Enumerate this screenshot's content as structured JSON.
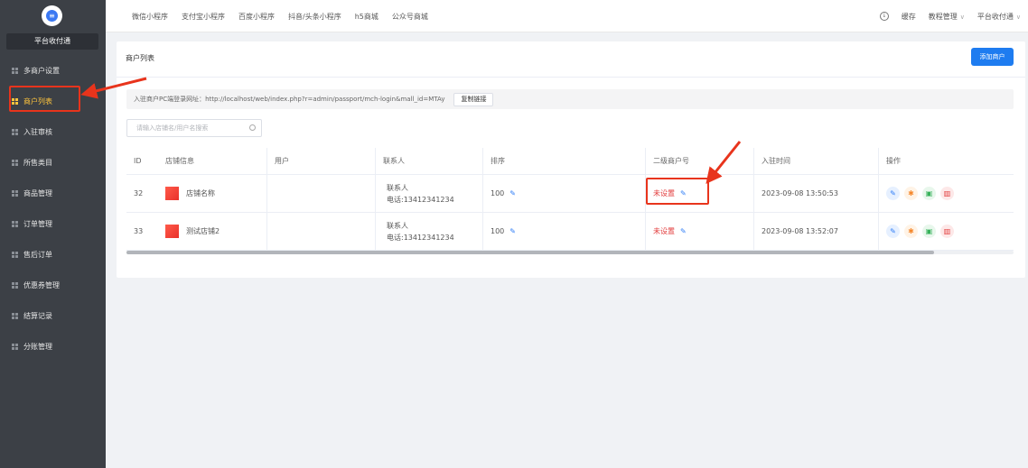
{
  "sidebar": {
    "logo_glyph": "≡",
    "platform_name": "平台收付通",
    "items": [
      {
        "label": "多商户设置",
        "active": false
      },
      {
        "label": "商户列表",
        "active": true
      },
      {
        "label": "入驻审核",
        "active": false
      },
      {
        "label": "所售类目",
        "active": false
      },
      {
        "label": "商品管理",
        "active": false
      },
      {
        "label": "订单管理",
        "active": false
      },
      {
        "label": "售后订单",
        "active": false
      },
      {
        "label": "优惠券管理",
        "active": false
      },
      {
        "label": "结算记录",
        "active": false
      },
      {
        "label": "分账管理",
        "active": false
      }
    ]
  },
  "topbar": {
    "tabs": [
      "微信小程序",
      "支付宝小程序",
      "百度小程序",
      "抖音/头条小程序",
      "h5商城",
      "公众号商城"
    ],
    "cache_label": "缓存",
    "tutorial_label": "教程管理",
    "user_label": "平台收付通",
    "caret": "∨"
  },
  "page": {
    "title": "商户列表",
    "add_button": "添加商户",
    "url_label": "入驻商户PC端登录网址：http://localhost/web/index.php?r=admin/passport/mch-login&mall_id=MTAy",
    "copy_button": "复制链接",
    "search_placeholder": "请输入店铺名/用户名搜索"
  },
  "table": {
    "headers": {
      "id": "ID",
      "shop": "店铺信息",
      "user": "用户",
      "contact": "联系人",
      "sort": "排序",
      "sub_merchant": "二级商户号",
      "join_time": "入驻时间",
      "actions": "操作"
    },
    "rows": [
      {
        "id": "32",
        "shop_name": "店铺名称",
        "user": "",
        "contact_name": "联系人",
        "contact_phone": "电话:13412341234",
        "sort": "100",
        "sub_merchant": "未设置",
        "join_time": "2023-09-08 13:50:53"
      },
      {
        "id": "33",
        "shop_name": "测试店铺2",
        "user": "",
        "contact_name": "联系人",
        "contact_phone": "电话:13412341234",
        "sort": "100",
        "sub_merchant": "未设置",
        "join_time": "2023-09-08 13:52:07"
      }
    ],
    "scroll_fraction": 0.91
  },
  "colors": {
    "sidebar_bg": "#3c4046",
    "active_menu": "#ffc53d",
    "primary": "#1e7cf0",
    "danger": "#e23b3b",
    "annotation": "#e8341c"
  }
}
